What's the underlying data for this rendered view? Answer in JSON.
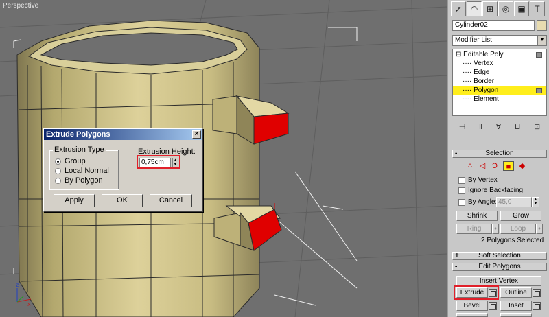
{
  "viewport": {
    "label": "Perspective"
  },
  "dialog": {
    "title": "Extrude Polygons",
    "close": "×",
    "extrusion_type_label": "Extrusion Type",
    "options": [
      {
        "label": "Group",
        "selected": true
      },
      {
        "label": "Local Normal",
        "selected": false
      },
      {
        "label": "By Polygon",
        "selected": false
      }
    ],
    "height_label": "Extrusion Height:",
    "height_value": "0,75cm",
    "buttons": {
      "apply": "Apply",
      "ok": "OK",
      "cancel": "Cancel"
    }
  },
  "panel": {
    "object_name": "Cylinder02",
    "modifier_list": "Modifier List",
    "stack": [
      {
        "label": "Editable Poly",
        "icon": "minus-box-icon"
      },
      {
        "label": "Vertex"
      },
      {
        "label": "Edge"
      },
      {
        "label": "Border"
      },
      {
        "label": "Polygon",
        "selected": true
      },
      {
        "label": "Element"
      }
    ],
    "selection": {
      "title": "Selection",
      "by_vertex": "By Vertex",
      "ignore_backfacing": "Ignore Backfacing",
      "by_angle": "By Angle:",
      "angle_value": "45,0",
      "shrink": "Shrink",
      "grow": "Grow",
      "ring": "Ring",
      "loop": "Loop",
      "status": "2 Polygons Selected"
    },
    "soft_selection": {
      "title": "Soft Selection",
      "pm": "+"
    },
    "edit_polygons": {
      "title": "Edit Polygons",
      "pm": "-",
      "insert_vertex": "Insert Vertex",
      "extrude": "Extrude",
      "outline": "Outline",
      "bevel": "Bevel",
      "inset": "Inset"
    }
  },
  "colors": {
    "extrude_highlight": "#e0202a",
    "selected_face": "#e00000",
    "object": "#d8cc90"
  }
}
